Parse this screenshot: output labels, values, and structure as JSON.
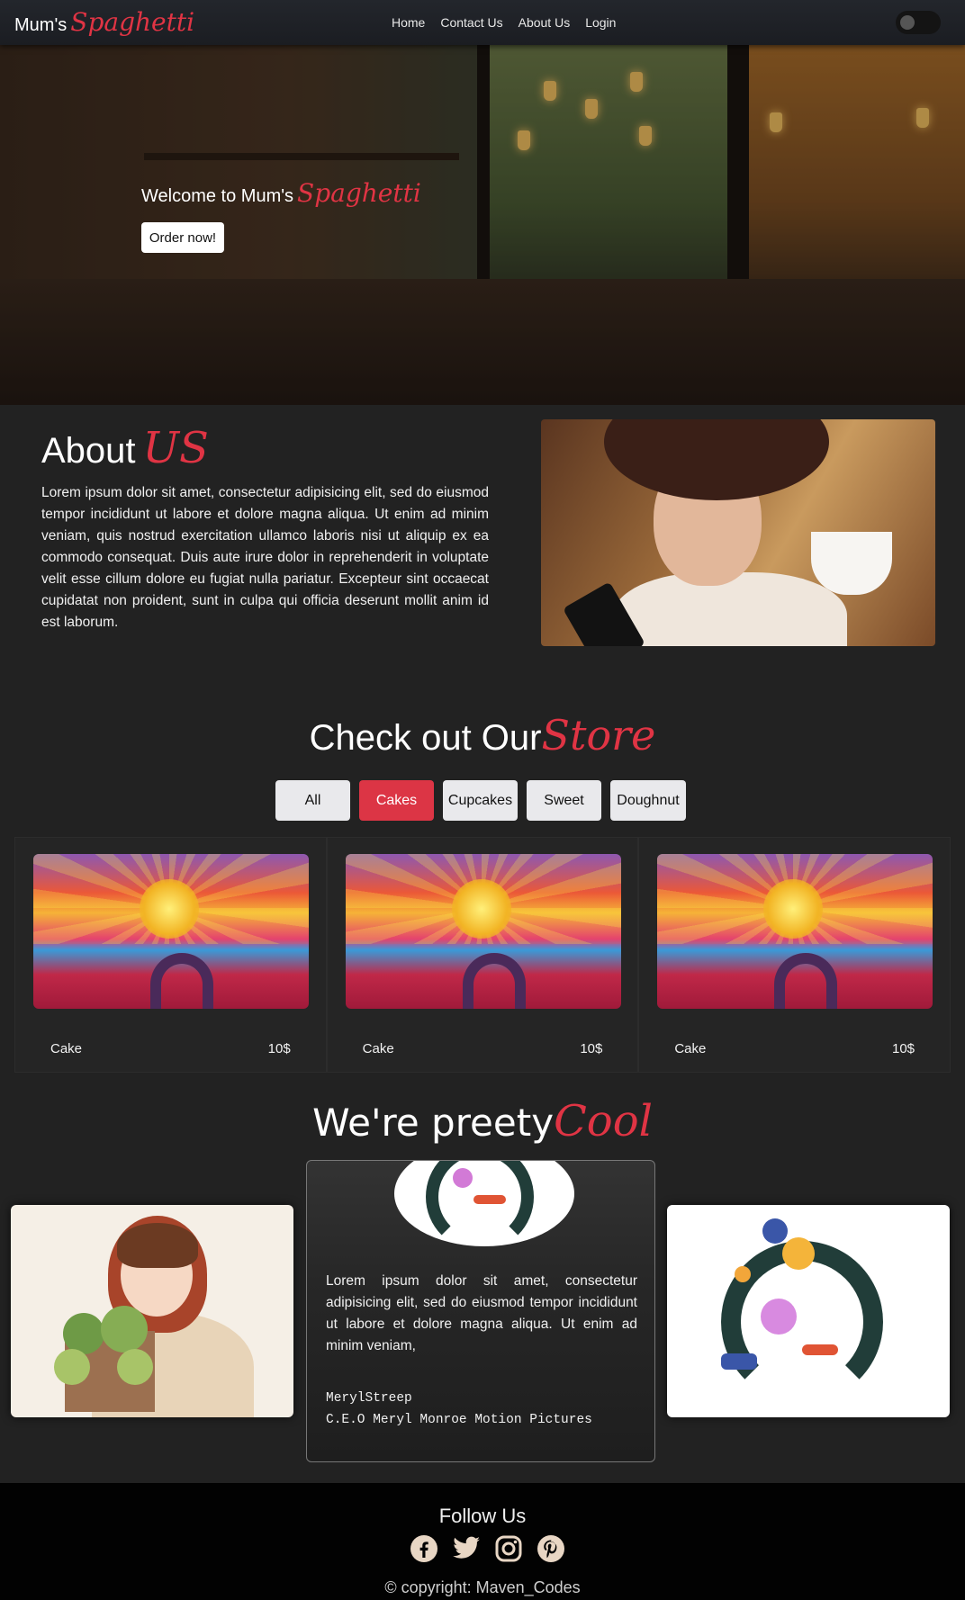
{
  "navbar": {
    "brand_prefix": "Mum's",
    "brand_script": "Spaghetti",
    "links": [
      "Home",
      "Contact Us",
      "About Us",
      "Login"
    ]
  },
  "hero": {
    "welcome_prefix": "Welcome to Mum's",
    "welcome_script": "Spaghetti",
    "order_button": "Order now!"
  },
  "about": {
    "title": "About",
    "title_script": "US",
    "text": "Lorem ipsum dolor sit amet, consectetur adipisicing elit, sed do eiusmod tempor incididunt ut labore et dolore magna aliqua. Ut enim ad minim veniam, quis nostrud exercitation ullamco laboris nisi ut aliquip ex ea commodo consequat. Duis aute irure dolor in reprehenderit in voluptate velit esse cillum dolore eu fugiat nulla pariatur. Excepteur sint occaecat cupidatat non proident, sunt in culpa qui officia deserunt mollit anim id est laborum."
  },
  "store": {
    "title": "Check out Our",
    "title_script": "Store",
    "filters": [
      "All",
      "Cakes",
      "Cupcakes",
      "Sweet",
      "Doughnut"
    ],
    "active_filter": "Cakes",
    "products": [
      {
        "name": "Cake",
        "price": "10$"
      },
      {
        "name": "Cake",
        "price": "10$"
      },
      {
        "name": "Cake",
        "price": "10$"
      }
    ]
  },
  "testimonial": {
    "title": "We're preety",
    "title_script": "Cool",
    "quote": "Lorem ipsum dolor sit amet, consectetur adipisicing elit, sed do eiusmod tempor incididunt ut labore et dolore magna aliqua. Ut enim ad minim veniam,",
    "author_name": "MerylStreep",
    "author_title": "C.E.O Meryl Monroe Motion Pictures"
  },
  "footer": {
    "follow": "Follow Us",
    "socials": [
      "facebook-icon",
      "twitter-icon",
      "instagram-icon",
      "pinterest-icon"
    ],
    "copyright": "© copyright: Maven_Codes"
  },
  "colors": {
    "accent": "#e03444",
    "background": "#222222",
    "footer": "#020202",
    "active_filter": "#dc3545"
  }
}
